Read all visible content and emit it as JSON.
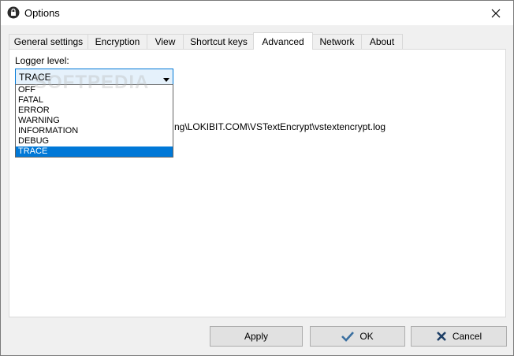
{
  "window": {
    "title": "Options"
  },
  "tabs": [
    {
      "label": "General settings"
    },
    {
      "label": "Encryption"
    },
    {
      "label": "View"
    },
    {
      "label": "Shortcut keys"
    },
    {
      "label": "Advanced",
      "active": true
    },
    {
      "label": "Network"
    },
    {
      "label": "About"
    }
  ],
  "advanced": {
    "logger_label": "Logger level:",
    "selected_level": "TRACE",
    "levels": [
      "OFF",
      "FATAL",
      "ERROR",
      "WARNING",
      "INFORMATION",
      "DEBUG",
      "TRACE"
    ],
    "log_path_visible": "ng\\LOKIBIT.COM\\VSTextEncrypt\\vstextencrypt.log"
  },
  "watermark": "SOFTPEDIA",
  "buttons": {
    "apply": "Apply",
    "ok": "OK",
    "cancel": "Cancel"
  },
  "colors": {
    "accent": "#0078d7",
    "ok_icon": "#3a6fa0",
    "cancel_icon": "#1e3f66"
  }
}
